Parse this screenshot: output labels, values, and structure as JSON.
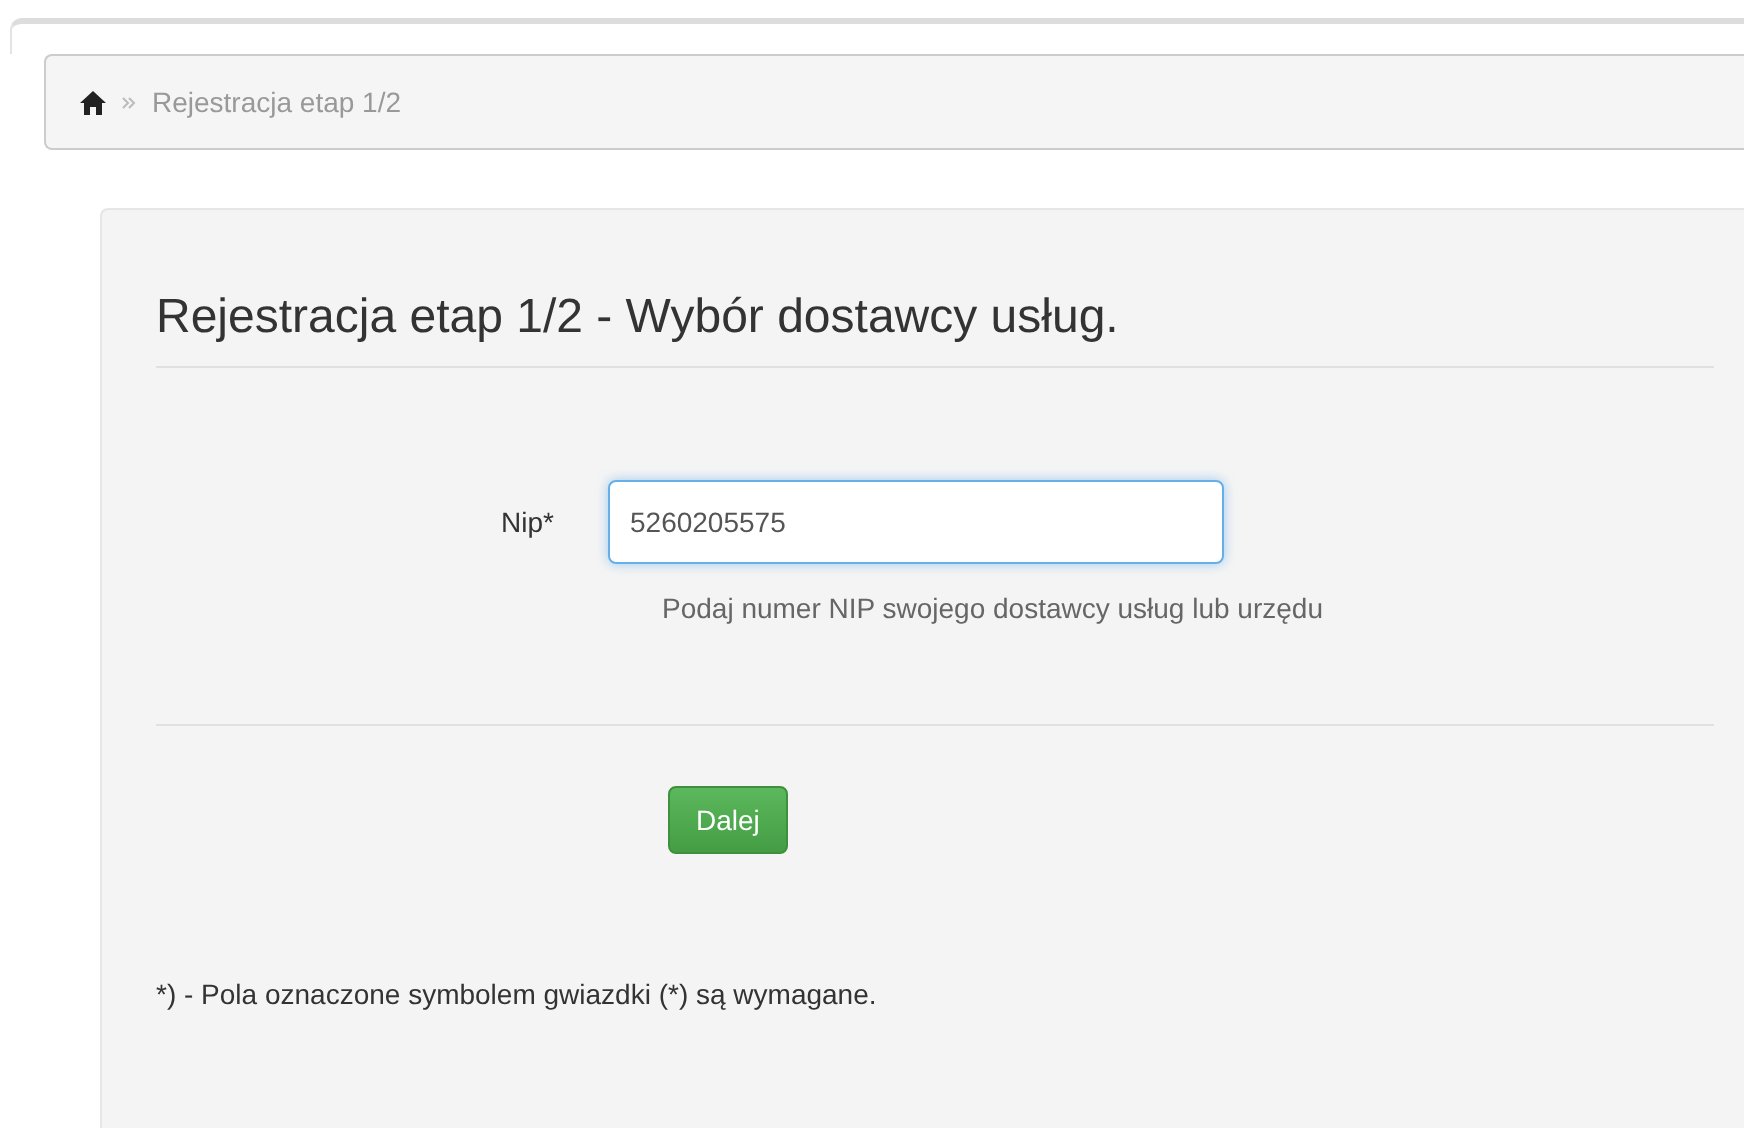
{
  "breadcrumb": {
    "items": [
      {
        "label": "Rejestracja etap 1/2"
      }
    ]
  },
  "form": {
    "title": "Rejestracja etap 1/2 - Wybór dostawcy usług.",
    "field": {
      "label": "Nip*",
      "value": "5260205575",
      "focused": true,
      "help": "Podaj numer NIP swojego dostawcy usług lub urzędu"
    },
    "submit": "Dalej",
    "footnote": "*) - Pola oznaczone symbolem gwiazdki (*) są wymagane."
  }
}
